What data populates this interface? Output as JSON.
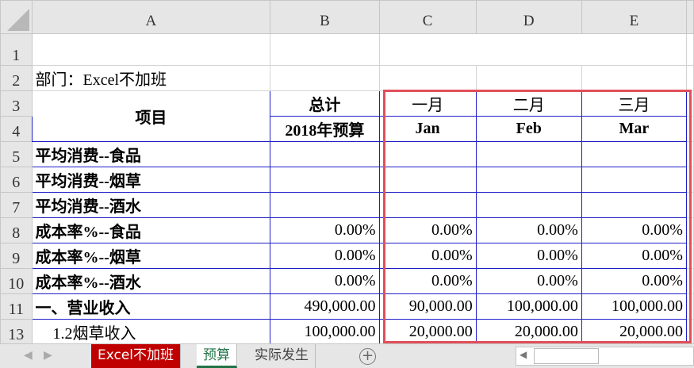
{
  "columns": [
    "A",
    "B",
    "C",
    "D",
    "E"
  ],
  "row_numbers": [
    "1",
    "2",
    "3",
    "4",
    "5",
    "6",
    "7",
    "8",
    "9",
    "10",
    "11",
    "13"
  ],
  "dept_label": "部门：Excel不加班",
  "header": {
    "item": "项目",
    "total": "总计",
    "budget": "2018年预算",
    "m1": "一月",
    "m1en": "Jan",
    "m2": "二月",
    "m2en": "Feb",
    "m3": "三月",
    "m3en": "Mar"
  },
  "rows": [
    {
      "label": "平均消费--食品",
      "b": "",
      "c": "",
      "d": "",
      "e": ""
    },
    {
      "label": "平均消费--烟草",
      "b": "",
      "c": "",
      "d": "",
      "e": ""
    },
    {
      "label": "平均消费--酒水",
      "b": "",
      "c": "",
      "d": "",
      "e": ""
    },
    {
      "label": "成本率%--食品",
      "b": "0.00%",
      "c": "0.00%",
      "d": "0.00%",
      "e": "0.00%"
    },
    {
      "label": "成本率%--烟草",
      "b": "0.00%",
      "c": "0.00%",
      "d": "0.00%",
      "e": "0.00%"
    },
    {
      "label": "成本率%--酒水",
      "b": "0.00%",
      "c": "0.00%",
      "d": "0.00%",
      "e": "0.00%"
    },
    {
      "label": "一、营业收入",
      "b": "490,000.00",
      "c": "90,000.00",
      "d": "100,000.00",
      "e": "100,000.00"
    },
    {
      "label": "1.2烟草收入",
      "b": "100,000.00",
      "c": "20,000.00",
      "d": "20,000.00",
      "e": "20,000.00"
    }
  ],
  "sheets": [
    "Excel不加班",
    "预算",
    "实际发生"
  ],
  "highlight_color": "#e0505a",
  "border_color": "#1f1fc8"
}
